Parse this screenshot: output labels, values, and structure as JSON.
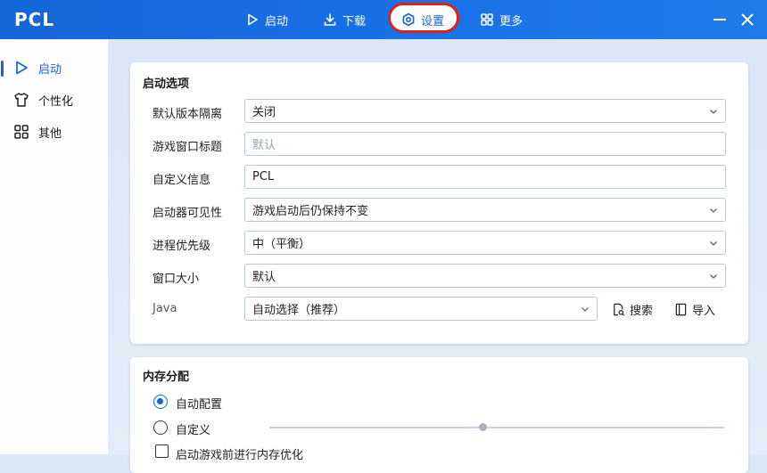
{
  "app": {
    "title": "PCL"
  },
  "nav": {
    "tabs": [
      {
        "label": "启动",
        "icon": "play-icon"
      },
      {
        "label": "下载",
        "icon": "download-icon"
      },
      {
        "label": "设置",
        "icon": "settings-icon"
      },
      {
        "label": "更多",
        "icon": "grid-icon"
      }
    ],
    "active_tab": "设置"
  },
  "sidebar": {
    "items": [
      {
        "label": "启动",
        "icon": "play-icon"
      },
      {
        "label": "个性化",
        "icon": "shirt-icon"
      },
      {
        "label": "其他",
        "icon": "grid-icon"
      }
    ],
    "active_item": "启动"
  },
  "launch_options": {
    "title": "启动选项",
    "rows": [
      {
        "label": "默认版本隔离",
        "value": "关闭",
        "type": "select"
      },
      {
        "label": "游戏窗口标题",
        "placeholder": "默认",
        "value": "",
        "type": "text"
      },
      {
        "label": "自定义信息",
        "value": "PCL",
        "type": "text"
      },
      {
        "label": "启动器可见性",
        "value": "游戏启动后仍保持不变",
        "type": "select"
      },
      {
        "label": "进程优先级",
        "value": "中（平衡）",
        "type": "select"
      },
      {
        "label": "窗口大小",
        "value": "默认",
        "type": "select"
      },
      {
        "label": "Java",
        "value": "自动选择（推荐）",
        "type": "select"
      }
    ],
    "java_search_label": "搜索",
    "java_import_label": "导入"
  },
  "memory": {
    "title": "内存分配",
    "auto_label": "自动配置",
    "custom_label": "自定义",
    "selected": "自动配置",
    "optimize_label": "启动游戏前进行内存优化"
  },
  "colors": {
    "accent": "#1565d8",
    "highlight_ring": "#e0201e"
  }
}
